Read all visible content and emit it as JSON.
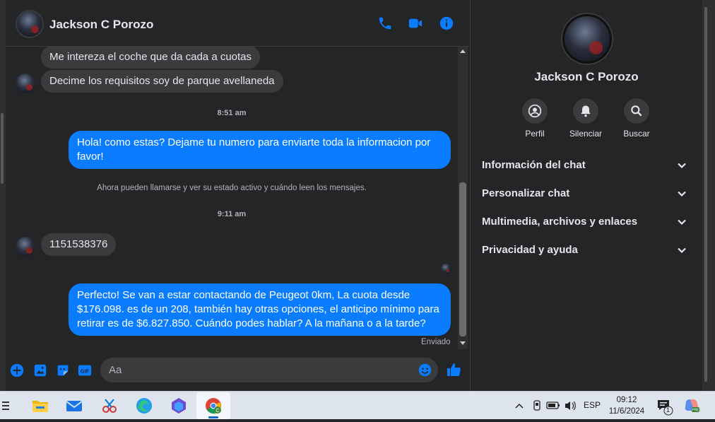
{
  "chat": {
    "contact_name": "Jackson C Porozo",
    "messages": [
      {
        "dir": "in",
        "text": "Me intereza el coche que da cada a cuotas"
      },
      {
        "dir": "in",
        "text": "Decime los requisitos soy de parque avellaneda"
      },
      {
        "type": "time",
        "text": "8:51 am"
      },
      {
        "dir": "out",
        "text": "Hola! como estas? Dejame tu numero para enviarte toda la informacion por favor!"
      },
      {
        "type": "system",
        "text": "Ahora pueden llamarse y ver su estado activo y cuándo leen los mensajes."
      },
      {
        "type": "time",
        "text": "9:11 am"
      },
      {
        "dir": "in",
        "text": "1151538376"
      },
      {
        "dir": "out",
        "text": "Perfecto!  Se van a estar contactando de Peugeot 0km, La cuota desde $176.098. es de un 208, también hay otras opciones, el anticipo mínimo para retirar es de $6.827.850. Cuándo podes hablar? A la mañana o a la tarde?"
      }
    ],
    "sent_status": "Enviado",
    "composer_placeholder": "Aa"
  },
  "panel": {
    "name": "Jackson C Porozo",
    "actions": [
      {
        "label": "Perfil",
        "icon": "profile-icon"
      },
      {
        "label": "Silenciar",
        "icon": "bell-icon"
      },
      {
        "label": "Buscar",
        "icon": "search-icon"
      }
    ],
    "sections": [
      "Información del chat",
      "Personalizar chat",
      "Multimedia, archivos y enlaces",
      "Privacidad y ayuda"
    ]
  },
  "taskbar": {
    "language": "ESP",
    "time": "09:12",
    "date": "11/6/2024",
    "notification_count": "1"
  },
  "colors": {
    "background": "#242526",
    "bubble_out": "#0a7cff",
    "bubble_in": "#3a3b3c",
    "accent": "#0a7cff"
  }
}
